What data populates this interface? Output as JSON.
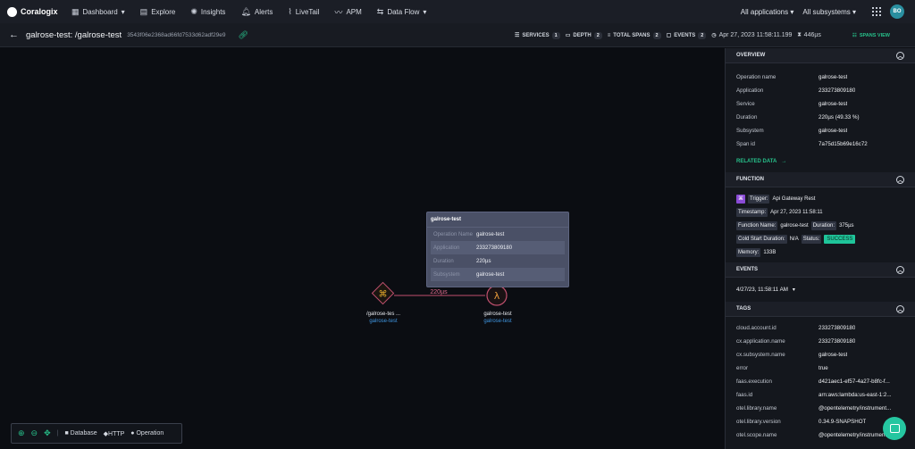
{
  "app": {
    "name": "Coralogix"
  },
  "nav": {
    "items": [
      {
        "label": "Dashboard",
        "icon": "dashboard-icon",
        "dropdown": true
      },
      {
        "label": "Explore",
        "icon": "explore-icon"
      },
      {
        "label": "Insights",
        "icon": "insights-icon"
      },
      {
        "label": "Alerts",
        "icon": "bell-icon"
      },
      {
        "label": "LiveTail",
        "icon": "livetail-icon"
      },
      {
        "label": "APM",
        "icon": "apm-icon"
      },
      {
        "label": "Data Flow",
        "icon": "dataflow-icon",
        "dropdown": true
      }
    ],
    "applications": "All applications",
    "subsystems": "All subsystems",
    "avatar": "BO"
  },
  "trace": {
    "title": "galrose-test: /galrose-test",
    "id": "3543f06e2368ad66fd7533d62adf29e9",
    "stats": {
      "services_label": "SERVICES",
      "services": "1",
      "depth_label": "DEPTH",
      "depth": "2",
      "total_spans_label": "TOTAL SPANS",
      "total_spans": "2",
      "events_label": "EVENTS",
      "events": "2",
      "timestamp": "Apr 27, 2023 11:58:11.199",
      "duration": "446µs"
    },
    "spans_view": "SPANS VIEW"
  },
  "graph": {
    "tooltip": {
      "title": "galrose-test",
      "rows": [
        {
          "k": "Operation Name",
          "v": "galrose-test"
        },
        {
          "k": "Application",
          "v": "233273809180"
        },
        {
          "k": "Duration",
          "v": "220µs"
        },
        {
          "k": "Subsystem",
          "v": "galrose-test"
        }
      ]
    },
    "edge_label": "220µs",
    "node_a": {
      "name": "/galrose-tes ...",
      "service": "galrose-test",
      "glyph": "⌘"
    },
    "node_b": {
      "name": "galrose-test",
      "service": "galrose-test",
      "glyph": "λ"
    }
  },
  "legend": {
    "database": "Database",
    "http": "HTTP",
    "operation": "Operation"
  },
  "panel": {
    "overview": {
      "header": "OVERVIEW",
      "rows": [
        {
          "k": "Operation name",
          "v": "galrose-test"
        },
        {
          "k": "Application",
          "v": "233273809180"
        },
        {
          "k": "Service",
          "v": "galrose-test"
        },
        {
          "k": "Duration",
          "v": "220µs (49.33 %)"
        },
        {
          "k": "Subsystem",
          "v": "galrose-test"
        },
        {
          "k": "Span id",
          "v": "7a75d15b69e16c72"
        }
      ],
      "related": "RELATED DATA"
    },
    "function": {
      "header": "FUNCTION",
      "trigger_label": "Trigger:",
      "trigger": "Api Gateway Rest",
      "timestamp_label": "Timestamp:",
      "timestamp": "Apr 27, 2023 11:58:11",
      "fn_name_label": "Function Name:",
      "fn_name": "galrose-test",
      "duration_label": "Duration:",
      "duration": "375µs",
      "cold_label": "Cold Start Duration:",
      "cold": "N/A",
      "status_label": "Status:",
      "status": "SUCCESS",
      "memory_label": "Memory:",
      "memory": "133B"
    },
    "events": {
      "header": "EVENTS",
      "value": "4/27/23, 11:58:11 AM"
    },
    "tags": {
      "header": "TAGS",
      "rows": [
        {
          "k": "cloud.account.id",
          "v": "233273809180"
        },
        {
          "k": "cx.application.name",
          "v": "233273809180"
        },
        {
          "k": "cx.subsystem.name",
          "v": "galrose-test"
        },
        {
          "k": "error",
          "v": "true"
        },
        {
          "k": "faas.execution",
          "v": "d421aec1-ef57-4a27-b8fc-f..."
        },
        {
          "k": "faas.id",
          "v": "arn:aws:lambda:us-east-1:2..."
        },
        {
          "k": "otel.library.name",
          "v": "@opentelemetry/instrument..."
        },
        {
          "k": "otel.library.version",
          "v": "0.34.9-SNAPSHOT"
        },
        {
          "k": "otel.scope.name",
          "v": "@opentelemetry/instrument..."
        }
      ]
    }
  },
  "colors": {
    "accent": "#27c08a",
    "link": "#3f95e0",
    "edge": "#c0506e",
    "success": "#1fc59a"
  }
}
